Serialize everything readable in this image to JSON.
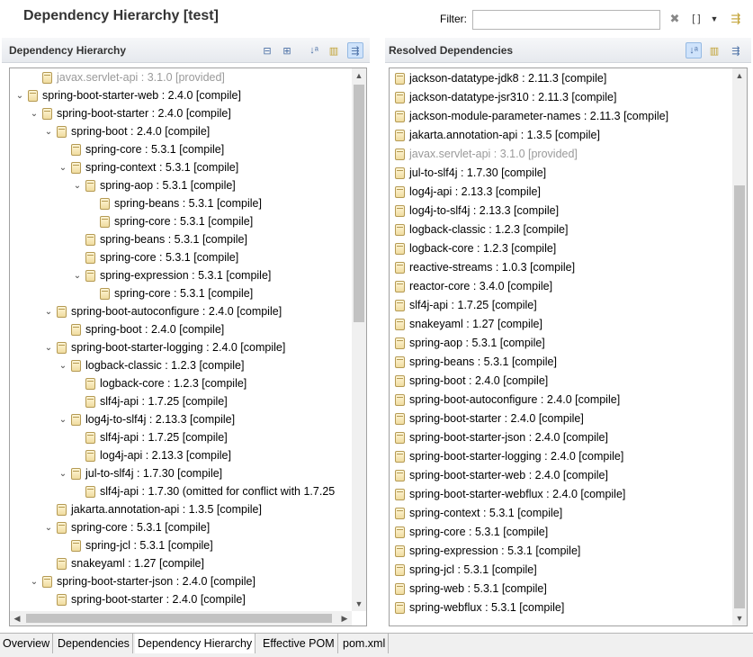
{
  "header": {
    "title": "Dependency Hierarchy [test]",
    "filter_label": "Filter:",
    "filter_value": "",
    "clear_icon": "clear-x-icon",
    "brackets_label": "[ ]",
    "dropdown_icon": "chevron-down-icon"
  },
  "left_panel": {
    "title": "Dependency Hierarchy",
    "toolbar": [
      "collapse-all-icon",
      "expand-all-icon",
      "sort-az-icon",
      "show-group-id-icon",
      "filter-conflicts-icon"
    ],
    "rows": [
      {
        "indent": 1,
        "twisty": "",
        "text": "javax.servlet-api : 3.1.0 [provided]",
        "muted": true
      },
      {
        "indent": 0,
        "twisty": "v",
        "text": "spring-boot-starter-web : 2.4.0 [compile]",
        "muted": false
      },
      {
        "indent": 1,
        "twisty": "v",
        "text": "spring-boot-starter : 2.4.0 [compile]",
        "muted": false
      },
      {
        "indent": 2,
        "twisty": "v",
        "text": "spring-boot : 2.4.0 [compile]",
        "muted": false
      },
      {
        "indent": 3,
        "twisty": "",
        "text": "spring-core : 5.3.1 [compile]",
        "muted": false
      },
      {
        "indent": 3,
        "twisty": "v",
        "text": "spring-context : 5.3.1 [compile]",
        "muted": false
      },
      {
        "indent": 4,
        "twisty": "v",
        "text": "spring-aop : 5.3.1 [compile]",
        "muted": false
      },
      {
        "indent": 5,
        "twisty": "",
        "text": "spring-beans : 5.3.1 [compile]",
        "muted": false
      },
      {
        "indent": 5,
        "twisty": "",
        "text": "spring-core : 5.3.1 [compile]",
        "muted": false
      },
      {
        "indent": 4,
        "twisty": "",
        "text": "spring-beans : 5.3.1 [compile]",
        "muted": false
      },
      {
        "indent": 4,
        "twisty": "",
        "text": "spring-core : 5.3.1 [compile]",
        "muted": false
      },
      {
        "indent": 4,
        "twisty": "v",
        "text": "spring-expression : 5.3.1 [compile]",
        "muted": false
      },
      {
        "indent": 5,
        "twisty": "",
        "text": "spring-core : 5.3.1 [compile]",
        "muted": false
      },
      {
        "indent": 2,
        "twisty": "v",
        "text": "spring-boot-autoconfigure : 2.4.0 [compile]",
        "muted": false
      },
      {
        "indent": 3,
        "twisty": "",
        "text": "spring-boot : 2.4.0 [compile]",
        "muted": false
      },
      {
        "indent": 2,
        "twisty": "v",
        "text": "spring-boot-starter-logging : 2.4.0 [compile]",
        "muted": false
      },
      {
        "indent": 3,
        "twisty": "v",
        "text": "logback-classic : 1.2.3 [compile]",
        "muted": false
      },
      {
        "indent": 4,
        "twisty": "",
        "text": "logback-core : 1.2.3 [compile]",
        "muted": false
      },
      {
        "indent": 4,
        "twisty": "",
        "text": "slf4j-api : 1.7.25 [compile]",
        "muted": false
      },
      {
        "indent": 3,
        "twisty": "v",
        "text": "log4j-to-slf4j : 2.13.3 [compile]",
        "muted": false
      },
      {
        "indent": 4,
        "twisty": "",
        "text": "slf4j-api : 1.7.25 [compile]",
        "muted": false
      },
      {
        "indent": 4,
        "twisty": "",
        "text": "log4j-api : 2.13.3 [compile]",
        "muted": false
      },
      {
        "indent": 3,
        "twisty": "v",
        "text": "jul-to-slf4j : 1.7.30 [compile]",
        "muted": false
      },
      {
        "indent": 4,
        "twisty": "",
        "text": "slf4j-api : 1.7.30 (omitted for conflict with 1.7.25",
        "muted": false
      },
      {
        "indent": 2,
        "twisty": "",
        "text": "jakarta.annotation-api : 1.3.5 [compile]",
        "muted": false
      },
      {
        "indent": 2,
        "twisty": "v",
        "text": "spring-core : 5.3.1 [compile]",
        "muted": false
      },
      {
        "indent": 3,
        "twisty": "",
        "text": "spring-jcl : 5.3.1 [compile]",
        "muted": false
      },
      {
        "indent": 2,
        "twisty": "",
        "text": "snakeyaml : 1.27 [compile]",
        "muted": false
      },
      {
        "indent": 1,
        "twisty": "v",
        "text": "spring-boot-starter-json : 2.4.0 [compile]",
        "muted": false
      },
      {
        "indent": 2,
        "twisty": "",
        "text": "spring-boot-starter : 2.4.0 [compile]",
        "muted": false
      }
    ]
  },
  "right_panel": {
    "title": "Resolved Dependencies",
    "toolbar": [
      "sort-az-icon",
      "show-group-id-icon",
      "filter-conflicts-icon"
    ],
    "rows": [
      {
        "text": "jackson-datatype-jdk8 : 2.11.3 [compile]",
        "muted": false
      },
      {
        "text": "jackson-datatype-jsr310 : 2.11.3 [compile]",
        "muted": false
      },
      {
        "text": "jackson-module-parameter-names : 2.11.3 [compile]",
        "muted": false
      },
      {
        "text": "jakarta.annotation-api : 1.3.5 [compile]",
        "muted": false
      },
      {
        "text": "javax.servlet-api : 3.1.0 [provided]",
        "muted": true
      },
      {
        "text": "jul-to-slf4j : 1.7.30 [compile]",
        "muted": false
      },
      {
        "text": "log4j-api : 2.13.3 [compile]",
        "muted": false
      },
      {
        "text": "log4j-to-slf4j : 2.13.3 [compile]",
        "muted": false
      },
      {
        "text": "logback-classic : 1.2.3 [compile]",
        "muted": false
      },
      {
        "text": "logback-core : 1.2.3 [compile]",
        "muted": false
      },
      {
        "text": "reactive-streams : 1.0.3 [compile]",
        "muted": false
      },
      {
        "text": "reactor-core : 3.4.0 [compile]",
        "muted": false
      },
      {
        "text": "slf4j-api : 1.7.25 [compile]",
        "muted": false
      },
      {
        "text": "snakeyaml : 1.27 [compile]",
        "muted": false
      },
      {
        "text": "spring-aop : 5.3.1 [compile]",
        "muted": false
      },
      {
        "text": "spring-beans : 5.3.1 [compile]",
        "muted": false
      },
      {
        "text": "spring-boot : 2.4.0 [compile]",
        "muted": false
      },
      {
        "text": "spring-boot-autoconfigure : 2.4.0 [compile]",
        "muted": false
      },
      {
        "text": "spring-boot-starter : 2.4.0 [compile]",
        "muted": false
      },
      {
        "text": "spring-boot-starter-json : 2.4.0 [compile]",
        "muted": false
      },
      {
        "text": "spring-boot-starter-logging : 2.4.0 [compile]",
        "muted": false
      },
      {
        "text": "spring-boot-starter-web : 2.4.0 [compile]",
        "muted": false
      },
      {
        "text": "spring-boot-starter-webflux : 2.4.0 [compile]",
        "muted": false
      },
      {
        "text": "spring-context : 5.3.1 [compile]",
        "muted": false
      },
      {
        "text": "spring-core : 5.3.1 [compile]",
        "muted": false
      },
      {
        "text": "spring-expression : 5.3.1 [compile]",
        "muted": false
      },
      {
        "text": "spring-jcl : 5.3.1 [compile]",
        "muted": false
      },
      {
        "text": "spring-web : 5.3.1 [compile]",
        "muted": false
      },
      {
        "text": "spring-webflux : 5.3.1 [compile]",
        "muted": false
      }
    ]
  },
  "tabs": [
    {
      "label": "Overview",
      "active": false
    },
    {
      "label": "Dependencies",
      "active": false
    },
    {
      "label": "Dependency Hierarchy",
      "active": true
    },
    {
      "label": "Effective POM",
      "active": false
    },
    {
      "label": "pom.xml",
      "active": false
    }
  ],
  "colors": {
    "muted_text": "#9a9a9a",
    "active_toolbar_bg": "#cfe3fb"
  }
}
